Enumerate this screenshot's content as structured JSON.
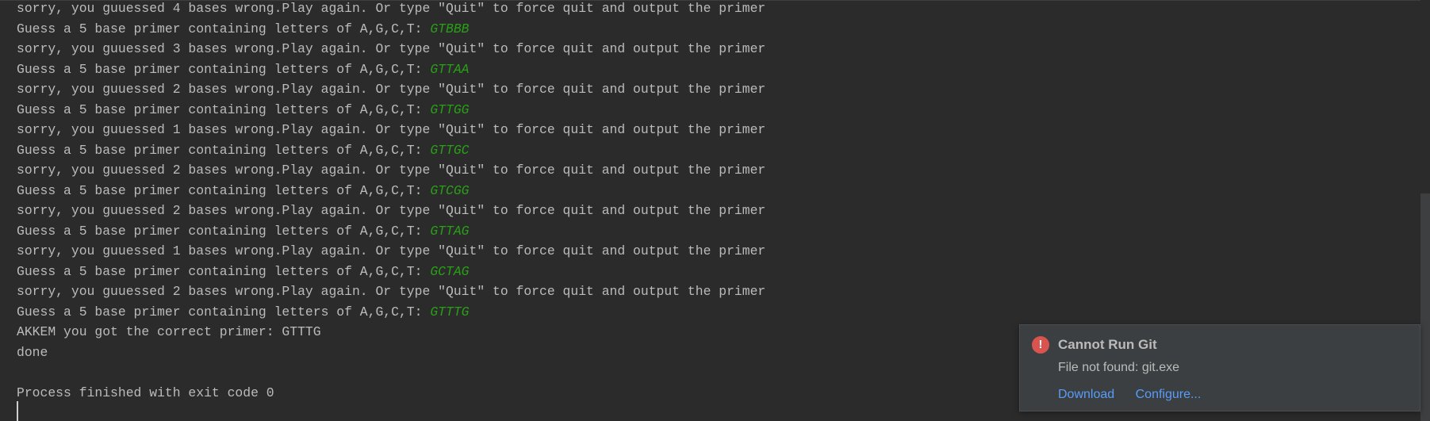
{
  "console": {
    "lines": [
      {
        "text": "sorry, you guuessed 4 bases wrong.Play again. Or type \"Quit\" to force quit and output the primer",
        "input": ""
      },
      {
        "text": "Guess a 5 base primer containing letters of A,G,C,T: ",
        "input": "GTBBB"
      },
      {
        "text": "sorry, you guuessed 3 bases wrong.Play again. Or type \"Quit\" to force quit and output the primer",
        "input": ""
      },
      {
        "text": "Guess a 5 base primer containing letters of A,G,C,T: ",
        "input": "GTTAA"
      },
      {
        "text": "sorry, you guuessed 2 bases wrong.Play again. Or type \"Quit\" to force quit and output the primer",
        "input": ""
      },
      {
        "text": "Guess a 5 base primer containing letters of A,G,C,T: ",
        "input": "GTTGG"
      },
      {
        "text": "sorry, you guuessed 1 bases wrong.Play again. Or type \"Quit\" to force quit and output the primer",
        "input": ""
      },
      {
        "text": "Guess a 5 base primer containing letters of A,G,C,T: ",
        "input": "GTTGC"
      },
      {
        "text": "sorry, you guuessed 2 bases wrong.Play again. Or type \"Quit\" to force quit and output the primer",
        "input": ""
      },
      {
        "text": "Guess a 5 base primer containing letters of A,G,C,T: ",
        "input": "GTCGG"
      },
      {
        "text": "sorry, you guuessed 2 bases wrong.Play again. Or type \"Quit\" to force quit and output the primer",
        "input": ""
      },
      {
        "text": "Guess a 5 base primer containing letters of A,G,C,T: ",
        "input": "GTTAG"
      },
      {
        "text": "sorry, you guuessed 1 bases wrong.Play again. Or type \"Quit\" to force quit and output the primer",
        "input": ""
      },
      {
        "text": "Guess a 5 base primer containing letters of A,G,C,T: ",
        "input": "GCTAG"
      },
      {
        "text": "sorry, you guuessed 2 bases wrong.Play again. Or type \"Quit\" to force quit and output the primer",
        "input": ""
      },
      {
        "text": "Guess a 5 base primer containing letters of A,G,C,T: ",
        "input": "GTTTG"
      },
      {
        "text": "AKKEM you got the correct primer: GTTTG",
        "input": ""
      },
      {
        "text": "done",
        "input": ""
      },
      {
        "text": "",
        "input": ""
      },
      {
        "text": "Process finished with exit code 0",
        "input": ""
      }
    ]
  },
  "notification": {
    "icon": "error-icon",
    "icon_glyph": "!",
    "title": "Cannot Run Git",
    "message": "File not found: git.exe",
    "actions": {
      "download": "Download",
      "configure": "Configure..."
    }
  },
  "colors": {
    "background": "#2b2b2b",
    "text": "#bbbbbb",
    "user_input": "#28a016",
    "link": "#589df6",
    "error": "#d9534f"
  }
}
